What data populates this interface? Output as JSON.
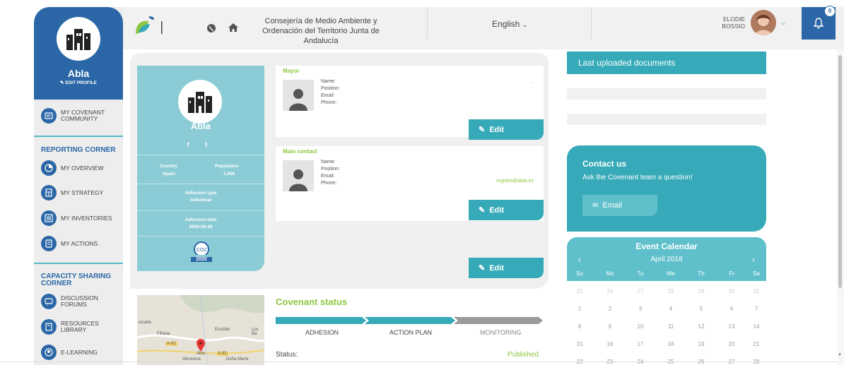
{
  "header": {
    "organization": "Consejería de Medio Ambiente y Ordenación del Territorio Junta de Andalucía",
    "language": "English",
    "user_name_line1": "ELODIE",
    "user_name_line2": "BOSSIO",
    "notifications_count": "0"
  },
  "sidebar": {
    "title": "Abla",
    "edit_profile": "EDIT PROFILE",
    "my_community": "MY COVENANT COMMUNITY",
    "reporting_corner": "REPORTING CORNER",
    "reporting_items": [
      "MY OVERVIEW",
      "MY STRATEGY",
      "MY INVENTORIES",
      "MY ACTIONS"
    ],
    "capacity_corner": "CAPACITY SHARING CORNER",
    "capacity_items": [
      "DISCUSSION FORUMS",
      "RESOURCES LIBRARY",
      "E-LEARNING"
    ]
  },
  "profile": {
    "name": "Abla",
    "social": "f  t",
    "country_label": "Country",
    "country": "Spain",
    "population_label": "Population",
    "population": "1,505",
    "adhesion_type_label": "Adhesion type",
    "adhesion_type": "individual",
    "adhesion_date_label": "Adhesion date",
    "adhesion_date": "2009-06-26",
    "badge_year": "2020"
  },
  "mayor": {
    "title": "Mayor",
    "fields": [
      "Name:",
      "Position:",
      "Email:",
      "Phone:"
    ],
    "dots": "...",
    "edit_label": "Edit"
  },
  "main_contact": {
    "title": "Main contact",
    "fields": [
      "Name:",
      "Position:",
      "Email:",
      "Phone:"
    ],
    "email_value": "registro@abla.es",
    "edit_label": "Edit"
  },
  "third_edit_label": "Edit",
  "map": {
    "labels": [
      "ezuela",
      "Fiñana",
      "Escúllar",
      "Los Ba",
      "A-92",
      "A-92",
      "Abla",
      "Abrucena",
      "Doña María"
    ]
  },
  "covenant": {
    "title": "Covenant status",
    "steps": [
      "ADHESION",
      "ACTION PLAN",
      "MONITORING"
    ],
    "status_label": "Status:",
    "status_value": "Published"
  },
  "documents": {
    "title": "Last uploaded documents"
  },
  "contact_us": {
    "title": "Contact us",
    "subtitle": "Ask the Covenant team a question!",
    "button": "Email"
  },
  "calendar": {
    "title": "Event Calendar",
    "month": "April 2018",
    "prev": "‹",
    "next": "›",
    "weekdays": [
      "Su",
      "Mo",
      "Tu",
      "We",
      "Th",
      "Fr",
      "Sa"
    ],
    "weeks": [
      [
        "25",
        "26",
        "27",
        "28",
        "29",
        "30",
        "31"
      ],
      [
        "1",
        "2",
        "3",
        "4",
        "5",
        "6",
        "7"
      ],
      [
        "8",
        "9",
        "10",
        "11",
        "12",
        "13",
        "14"
      ],
      [
        "15",
        "16",
        "17",
        "18",
        "19",
        "20",
        "21"
      ],
      [
        "22",
        "23",
        "24",
        "25",
        "26",
        "27",
        "28"
      ]
    ]
  },
  "colors": {
    "brand_blue": "#2b67a6",
    "teal": "#36aab8",
    "light_teal": "#8bcbd5",
    "green": "#8dc63f"
  }
}
